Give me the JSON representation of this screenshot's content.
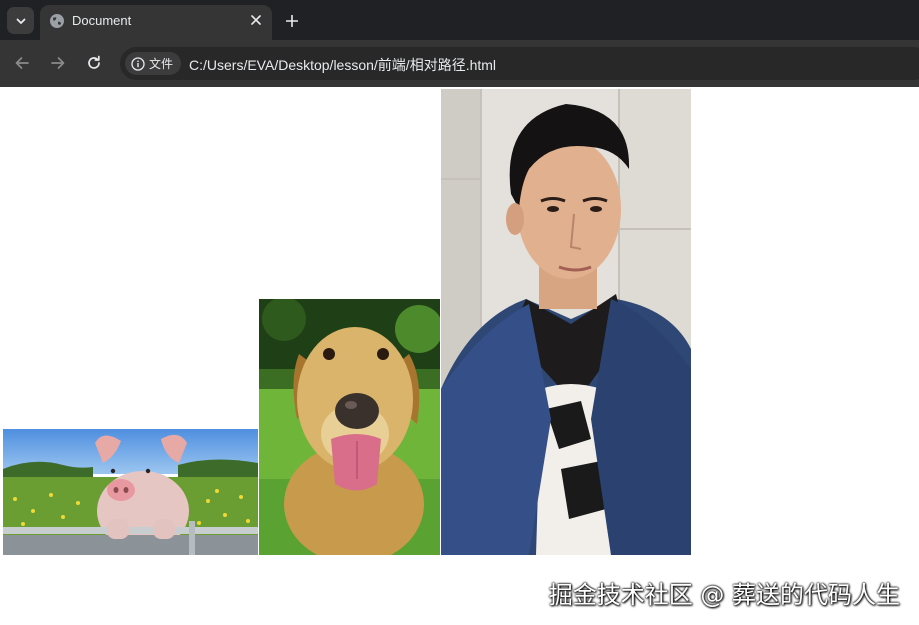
{
  "tab": {
    "title": "Document",
    "favicon": "globe-icon",
    "close_icon": "close-icon",
    "new_tab_icon": "plus-icon",
    "search_icon": "chevron-down-icon"
  },
  "toolbar": {
    "back_icon": "arrow-left-icon",
    "forward_icon": "arrow-right-icon",
    "reload_icon": "reload-icon",
    "site_info_icon": "info-icon",
    "site_info_label": "文件",
    "url": "C:/Users/EVA/Desktop/lesson/前端/相对路径.html"
  },
  "images": [
    {
      "name": "pig-photo",
      "subject": "pig"
    },
    {
      "name": "dog-photo",
      "subject": "dog"
    },
    {
      "name": "man-photo",
      "subject": "man"
    }
  ],
  "watermark": "掘金技术社区 @ 葬送的代码人生",
  "colors": {
    "tabstrip_bg": "#202124",
    "toolbar_bg": "#353535",
    "omnibox_bg": "#282828",
    "text": "#e8eaed",
    "page_bg": "#ffffff"
  }
}
